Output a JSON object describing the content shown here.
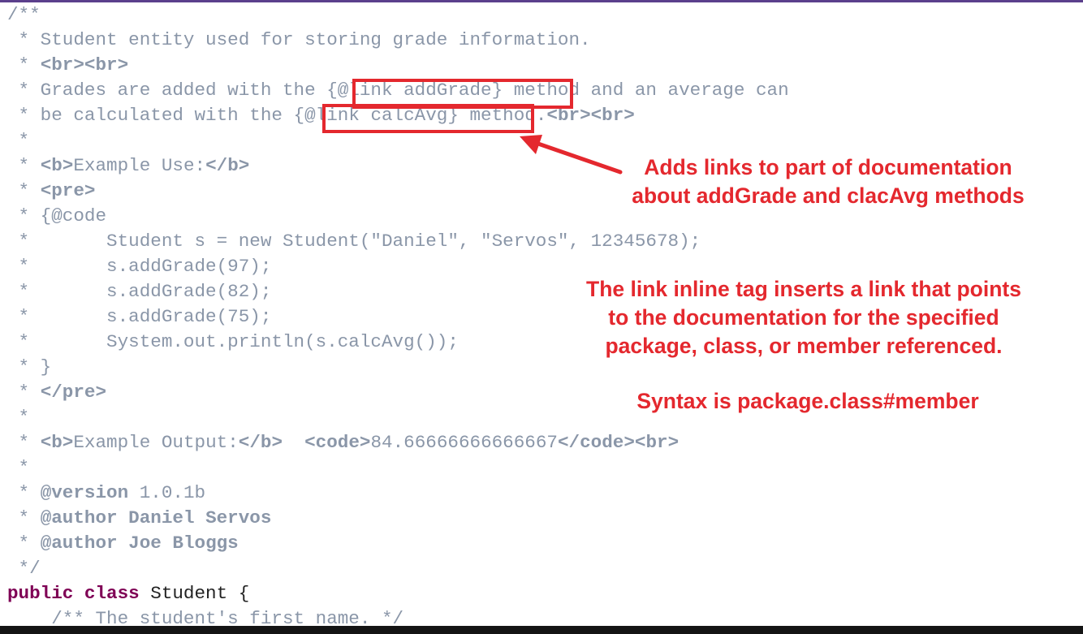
{
  "code_lines": [
    [
      {
        "t": "/**",
        "c": "comment"
      }
    ],
    [
      {
        "t": " * Student entity used for storing grade information.",
        "c": "comment"
      }
    ],
    [
      {
        "t": " * ",
        "c": "comment"
      },
      {
        "t": "<br><br>",
        "c": "tag"
      }
    ],
    [
      {
        "t": " * Grades are added with the ",
        "c": "comment"
      },
      {
        "t": "{@link addGrade}",
        "c": "link"
      },
      {
        "t": " method and an average can",
        "c": "comment"
      }
    ],
    [
      {
        "t": " * be calculated with the ",
        "c": "comment"
      },
      {
        "t": "{@link calcAvg}",
        "c": "link"
      },
      {
        "t": " method.",
        "c": "comment"
      },
      {
        "t": "<br><br>",
        "c": "tag"
      }
    ],
    [
      {
        "t": " *",
        "c": "comment"
      }
    ],
    [
      {
        "t": " * ",
        "c": "comment"
      },
      {
        "t": "<b>",
        "c": "tag"
      },
      {
        "t": "Example Use:",
        "c": "comment"
      },
      {
        "t": "</b>",
        "c": "tag"
      }
    ],
    [
      {
        "t": " * ",
        "c": "comment"
      },
      {
        "t": "<pre>",
        "c": "tag"
      }
    ],
    [
      {
        "t": " * {@code",
        "c": "comment"
      }
    ],
    [
      {
        "t": " *       Student s = new Student(\"Daniel\", \"Servos\", 12345678);",
        "c": "comment"
      }
    ],
    [
      {
        "t": " *       s.addGrade(97);",
        "c": "comment"
      }
    ],
    [
      {
        "t": " *       s.addGrade(82);",
        "c": "comment"
      }
    ],
    [
      {
        "t": " *       s.addGrade(75);",
        "c": "comment"
      }
    ],
    [
      {
        "t": " *       System.out.println(s.calcAvg());",
        "c": "comment"
      }
    ],
    [
      {
        "t": " * }",
        "c": "comment"
      }
    ],
    [
      {
        "t": " * ",
        "c": "comment"
      },
      {
        "t": "</pre>",
        "c": "tag"
      }
    ],
    [
      {
        "t": " *",
        "c": "comment"
      }
    ],
    [
      {
        "t": " * ",
        "c": "comment"
      },
      {
        "t": "<b>",
        "c": "tag"
      },
      {
        "t": "Example Output:",
        "c": "comment"
      },
      {
        "t": "</b>",
        "c": "tag"
      },
      {
        "t": "  ",
        "c": "comment"
      },
      {
        "t": "<code>",
        "c": "tag"
      },
      {
        "t": "84.66666666666667",
        "c": "comment"
      },
      {
        "t": "</code><br>",
        "c": "tag"
      }
    ],
    [
      {
        "t": " *",
        "c": "comment"
      }
    ],
    [
      {
        "t": " * ",
        "c": "comment"
      },
      {
        "t": "@version",
        "c": "doctag"
      },
      {
        "t": " 1.0.1b",
        "c": "comment"
      }
    ],
    [
      {
        "t": " * ",
        "c": "comment"
      },
      {
        "t": "@author Daniel Servos",
        "c": "doctag"
      }
    ],
    [
      {
        "t": " * ",
        "c": "comment"
      },
      {
        "t": "@author Joe Bloggs",
        "c": "doctag"
      }
    ],
    [
      {
        "t": " */",
        "c": "comment"
      }
    ],
    [
      {
        "t": "public class",
        "c": "kw"
      },
      {
        "t": " Student {",
        "c": "plain"
      }
    ],
    [
      {
        "t": "    /** The student's first name. */",
        "c": "comment"
      }
    ]
  ],
  "annotations": {
    "top_line1": "Adds links to part of documentation",
    "top_line2": "about addGrade and clacAvg methods",
    "mid_line1": "The link inline tag inserts a link that points",
    "mid_line2": "to the documentation for the specified",
    "mid_line3": "package, class, or member referenced.",
    "syntax": "Syntax is package.class#member"
  },
  "colors": {
    "comment": "#8a96a8",
    "tag": "#8a96a8",
    "doctag": "#8a96a8",
    "keyword": "#7f0055",
    "plain": "#222222",
    "annotation": "#e4282e",
    "top_bar": "#5b3f8c",
    "bottom_bar": "#141414"
  }
}
